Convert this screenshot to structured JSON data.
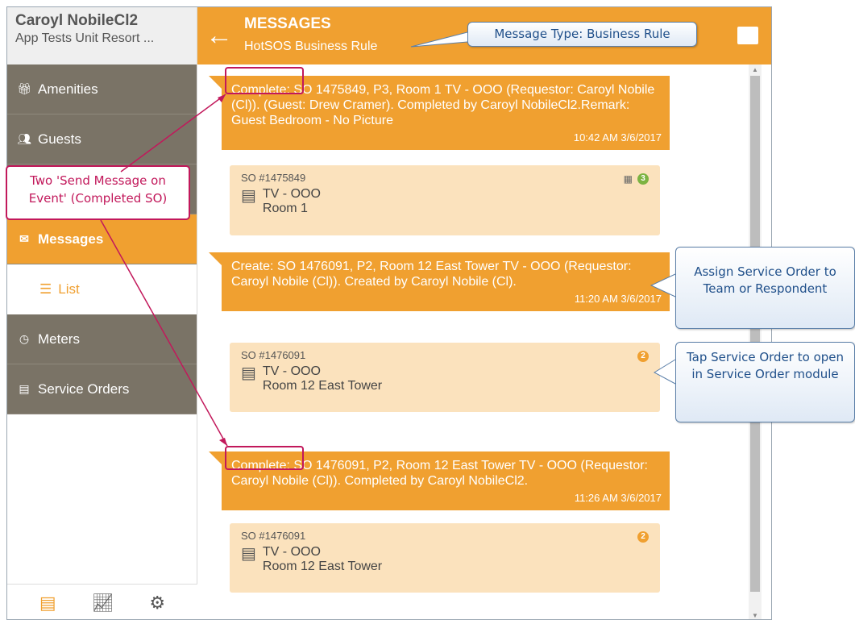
{
  "user": {
    "name": "Caroyl NobileCl2",
    "property": "App Tests Unit Resort ..."
  },
  "sidebar": {
    "items": [
      {
        "label": "Amenities",
        "icon": "gift-icon"
      },
      {
        "label": "Guests",
        "icon": "users-icon"
      },
      {
        "label": "Messages",
        "icon": "envelope-icon"
      },
      {
        "label": "List",
        "icon": "list-icon"
      },
      {
        "label": "Meters",
        "icon": "gauge-icon"
      },
      {
        "label": "Service Orders",
        "icon": "clipboard-icon"
      }
    ],
    "footer_icons": [
      "clipboard-icon",
      "chart-icon",
      "gear-icon"
    ]
  },
  "header": {
    "title": "MESSAGES",
    "subtitle": "HotSOS Business Rule"
  },
  "messages": [
    {
      "text": "Complete: SO 1475849, P3, Room 1 TV - OOO (Requestor: Caroyl Nobile (Cl)). (Guest: Drew Cramer). Completed by Caroyl NobileCl2.Remark: Guest Bedroom - No Picture",
      "time": "10:42 AM 3/6/2017",
      "card": {
        "so": "SO #1475849",
        "type": "TV - OOO",
        "room": "Room 1",
        "badge": "3",
        "badge_color": "#7cb342",
        "has_clip": true
      }
    },
    {
      "text": "Create: SO 1476091, P2, Room 12 East Tower TV - OOO (Requestor: Caroyl Nobile (Cl)). Created by Caroyl Nobile (Cl).",
      "time": "11:20 AM 3/6/2017",
      "card": {
        "so": "SO #1476091",
        "type": "TV - OOO",
        "room": "Room 12 East Tower",
        "badge": "2",
        "badge_color": "#f0a030",
        "has_clip": false
      }
    },
    {
      "text": "Complete: SO 1476091, P2, Room 12 East Tower TV - OOO (Requestor: Caroyl Nobile (Cl)). Completed by Caroyl NobileCl2.",
      "time": "11:26 AM 3/6/2017",
      "card": {
        "so": "SO #1476091",
        "type": "TV - OOO",
        "room": "Room 12 East Tower",
        "badge": "2",
        "badge_color": "#f0a030",
        "has_clip": false
      }
    }
  ],
  "annotations": {
    "message_type": "Message Type: Business Rule",
    "two_send": "Two 'Send Message on Event' (Completed SO)",
    "assign": "Assign Service Order to Team or Respondent",
    "tap": "Tap Service Order to open in Service Order module"
  }
}
